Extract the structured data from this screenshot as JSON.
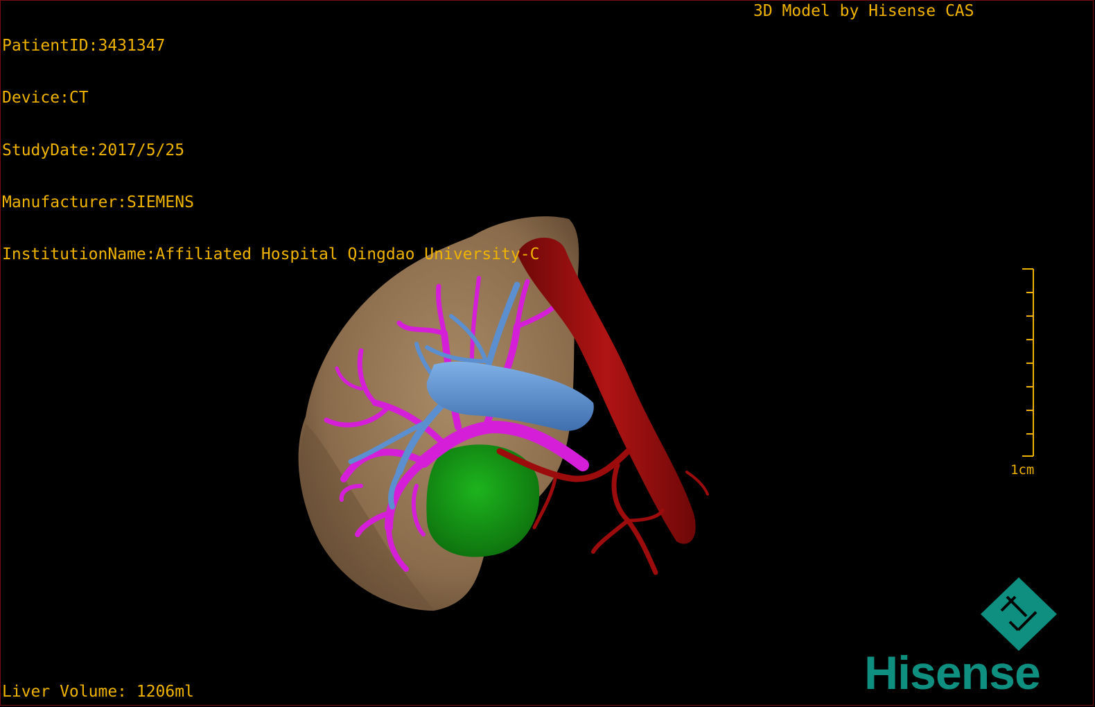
{
  "overlay": {
    "patient_id": "PatientID:3431347",
    "device": "Device:CT",
    "study_date": "StudyDate:2017/5/25",
    "manufacturer": "Manufacturer:SIEMENS",
    "institution": "InstitutionName:Affiliated Hospital Qingdao University-C",
    "credit": "3D Model by Hisense CAS",
    "liver_volume": "Liver Volume: 1206ml"
  },
  "scale_bar": {
    "label": "1cm"
  },
  "logo": {
    "brand": "Hisense",
    "icon": "hisense-diamond-icon"
  },
  "colors": {
    "overlay_text": "#f0b400",
    "liver": "#8a6c4c",
    "portal_vein": "#d41ed8",
    "hepatic_vein": "#5b8fcf",
    "tumor": "#128a12",
    "artery": "#9c0c0c",
    "brand": "#0f8f7f"
  }
}
